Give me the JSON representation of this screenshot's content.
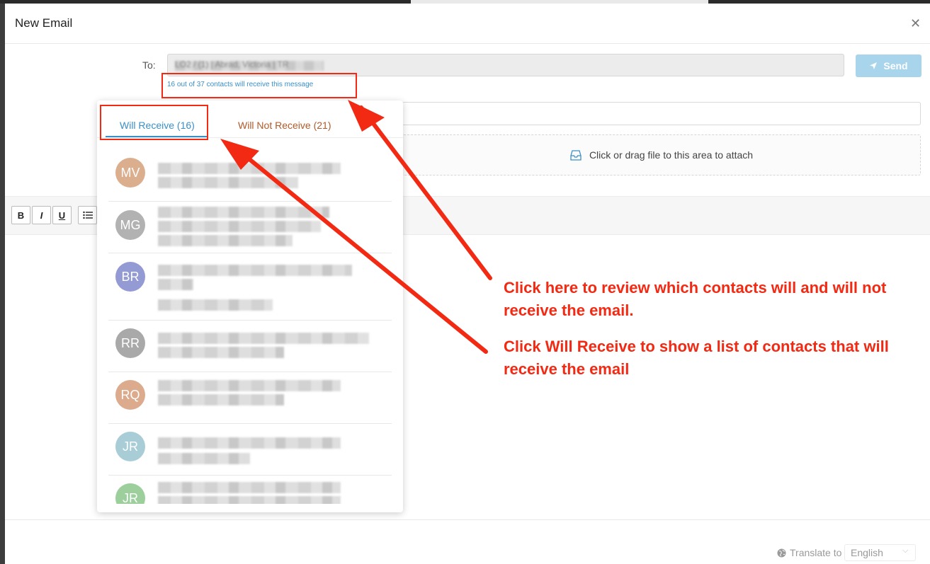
{
  "modal": {
    "title": "New Email",
    "close_icon": "close-icon"
  },
  "compose": {
    "to_label": "To:",
    "to_value": "LO2 / (1) | Abrad, Victoria | TR",
    "send_label": "Send",
    "send_icon": "paper-plane-icon",
    "recipients_summary": "16 out of 37 contacts will receive this message",
    "attach_text": "Click or drag file to this area to attach",
    "attach_icon": "inbox-icon"
  },
  "toolbar": {
    "bold": "B",
    "italic": "I",
    "underline": "U",
    "list_icon": "bullet-list-icon"
  },
  "recipients_dropdown": {
    "tabs": [
      {
        "label": "Will Receive (16)",
        "active": true
      },
      {
        "label": "Will Not Receive (21)",
        "active": false
      }
    ],
    "contacts": [
      {
        "initials": "MV",
        "color": "#dbae8e"
      },
      {
        "initials": "MG",
        "color": "#b2b2b2"
      },
      {
        "initials": "BR",
        "color": "#949ad4"
      },
      {
        "initials": "RR",
        "color": "#a9a9a9"
      },
      {
        "initials": "RQ",
        "color": "#dcab8d"
      },
      {
        "initials": "JR",
        "color": "#a9cdd7"
      },
      {
        "initials": "JR",
        "color": "#9ccf9c"
      }
    ]
  },
  "footer": {
    "translate_label": "Translate to",
    "translate_icon": "globe-icon",
    "language": "English"
  },
  "annotations": {
    "note_1": "Click here to review which contacts will and will not receive the email.",
    "note_2": "Click Will Receive to show a list of contacts that will receive the email",
    "color": "#f22a14"
  }
}
